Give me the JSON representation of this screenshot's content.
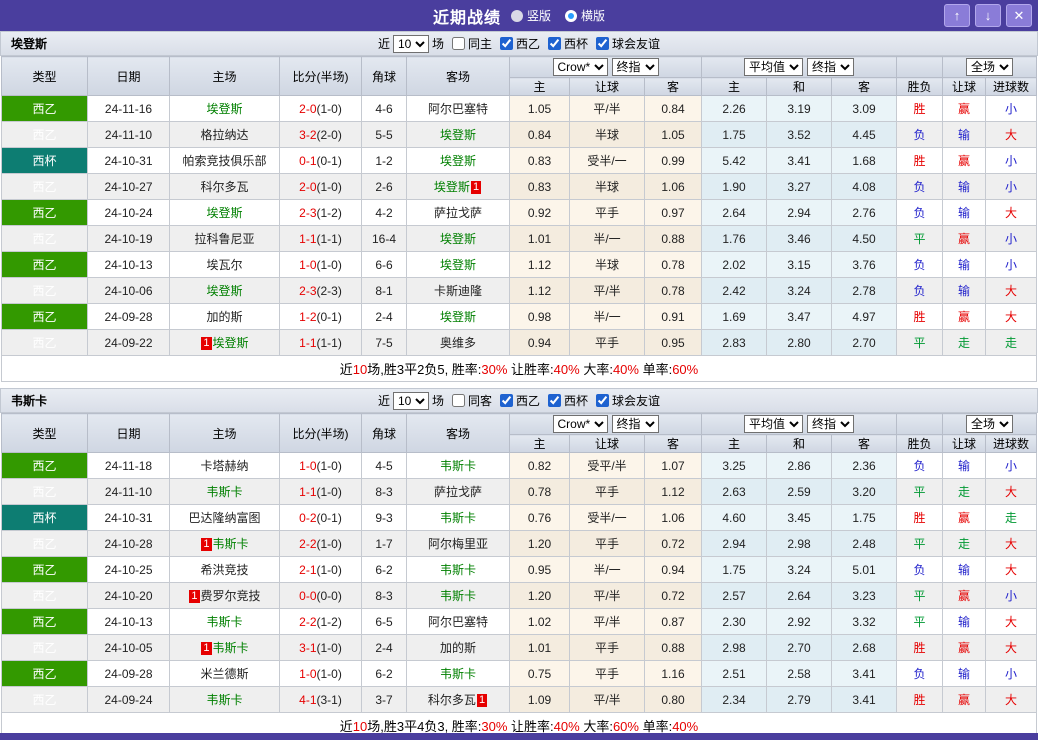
{
  "titlebar": {
    "title": "近期战绩",
    "radio_vertical": "竖版",
    "radio_horizontal": "横版",
    "btn_up": "↑",
    "btn_down": "↓",
    "btn_close": "✕",
    "bar_color": "#4a3e9e"
  },
  "table_header": {
    "cols": [
      "类型",
      "日期",
      "主场",
      "比分(半场)",
      "角球",
      "客场"
    ],
    "group1_selects": [
      "Crow*",
      "终指"
    ],
    "group1_sub": [
      "主",
      "让球",
      "客"
    ],
    "group2_selects": [
      "平均值",
      "终指"
    ],
    "group2_sub": [
      "主",
      "和",
      "客"
    ],
    "group3_select": "全场",
    "group3_sub": [
      "胜负",
      "让球",
      "进球数"
    ]
  },
  "colors": {
    "league_xiyi": "#339900",
    "league_xibei": "#0d7d72",
    "team_highlight": "#008000",
    "score_red": "#e60000",
    "win_red": "#e60000",
    "lose_blue": "#2222cc",
    "draw_green": "#009933"
  },
  "sections": [
    {
      "team": "埃登斯",
      "filter": {
        "near": "近",
        "count": "10",
        "games": "场",
        "same": "同主",
        "leagues": [
          {
            "label": "西乙",
            "checked": true
          },
          {
            "label": "西杯",
            "checked": true
          },
          {
            "label": "球会友谊",
            "checked": true
          }
        ],
        "same_checked": false
      },
      "rows": [
        {
          "lt": "西乙",
          "lc": "green",
          "date": "24-11-16",
          "home": "埃登斯",
          "hg": true,
          "hb": "",
          "score": "2-0",
          "half": "(1-0)",
          "corner": "4-6",
          "away": "阿尔巴塞特",
          "ag": false,
          "ab": "",
          "o1": [
            "1.05",
            "平/半",
            "0.84"
          ],
          "o2": [
            "2.26",
            "3.19",
            "3.09"
          ],
          "res": [
            [
              "胜",
              "r"
            ],
            [
              "赢",
              "r"
            ],
            [
              "小",
              "b"
            ]
          ]
        },
        {
          "lt": "西乙",
          "lc": "green",
          "date": "24-11-10",
          "home": "格拉纳达",
          "hg": false,
          "hb": "",
          "score": "3-2",
          "half": "(2-0)",
          "corner": "5-5",
          "away": "埃登斯",
          "ag": true,
          "ab": "",
          "o1": [
            "0.84",
            "半球",
            "1.05"
          ],
          "o2": [
            "1.75",
            "3.52",
            "4.45"
          ],
          "res": [
            [
              "负",
              "b"
            ],
            [
              "输",
              "b"
            ],
            [
              "大",
              "r"
            ]
          ]
        },
        {
          "lt": "西杯",
          "lc": "teal",
          "date": "24-10-31",
          "home": "帕索竞技俱乐部",
          "hg": false,
          "hb": "",
          "score": "0-1",
          "half": "(0-1)",
          "corner": "1-2",
          "away": "埃登斯",
          "ag": true,
          "ab": "",
          "o1": [
            "0.83",
            "受半/一",
            "0.99"
          ],
          "o2": [
            "5.42",
            "3.41",
            "1.68"
          ],
          "res": [
            [
              "胜",
              "r"
            ],
            [
              "赢",
              "r"
            ],
            [
              "小",
              "b"
            ]
          ]
        },
        {
          "lt": "西乙",
          "lc": "green",
          "date": "24-10-27",
          "home": "科尔多瓦",
          "hg": false,
          "hb": "",
          "score": "2-0",
          "half": "(1-0)",
          "corner": "2-6",
          "away": "埃登斯",
          "ag": true,
          "ab": "post",
          "o1": [
            "0.83",
            "半球",
            "1.06"
          ],
          "o2": [
            "1.90",
            "3.27",
            "4.08"
          ],
          "res": [
            [
              "负",
              "b"
            ],
            [
              "输",
              "b"
            ],
            [
              "小",
              "b"
            ]
          ]
        },
        {
          "lt": "西乙",
          "lc": "green",
          "date": "24-10-24",
          "home": "埃登斯",
          "hg": true,
          "hb": "",
          "score": "2-3",
          "half": "(1-2)",
          "corner": "4-2",
          "away": "萨拉戈萨",
          "ag": false,
          "ab": "",
          "o1": [
            "0.92",
            "平手",
            "0.97"
          ],
          "o2": [
            "2.64",
            "2.94",
            "2.76"
          ],
          "res": [
            [
              "负",
              "b"
            ],
            [
              "输",
              "b"
            ],
            [
              "大",
              "r"
            ]
          ]
        },
        {
          "lt": "西乙",
          "lc": "green",
          "date": "24-10-19",
          "home": "拉科鲁尼亚",
          "hg": false,
          "hb": "",
          "score": "1-1",
          "half": "(1-1)",
          "corner": "16-4",
          "away": "埃登斯",
          "ag": true,
          "ab": "",
          "o1": [
            "1.01",
            "半/一",
            "0.88"
          ],
          "o2": [
            "1.76",
            "3.46",
            "4.50"
          ],
          "res": [
            [
              "平",
              "g"
            ],
            [
              "赢",
              "r"
            ],
            [
              "小",
              "b"
            ]
          ]
        },
        {
          "lt": "西乙",
          "lc": "green",
          "date": "24-10-13",
          "home": "埃瓦尔",
          "hg": false,
          "hb": "",
          "score": "1-0",
          "half": "(1-0)",
          "corner": "6-6",
          "away": "埃登斯",
          "ag": true,
          "ab": "",
          "o1": [
            "1.12",
            "半球",
            "0.78"
          ],
          "o2": [
            "2.02",
            "3.15",
            "3.76"
          ],
          "res": [
            [
              "负",
              "b"
            ],
            [
              "输",
              "b"
            ],
            [
              "小",
              "b"
            ]
          ]
        },
        {
          "lt": "西乙",
          "lc": "green",
          "date": "24-10-06",
          "home": "埃登斯",
          "hg": true,
          "hb": "",
          "score": "2-3",
          "half": "(2-3)",
          "corner": "8-1",
          "away": "卡斯迪隆",
          "ag": false,
          "ab": "",
          "o1": [
            "1.12",
            "平/半",
            "0.78"
          ],
          "o2": [
            "2.42",
            "3.24",
            "2.78"
          ],
          "res": [
            [
              "负",
              "b"
            ],
            [
              "输",
              "b"
            ],
            [
              "大",
              "r"
            ]
          ]
        },
        {
          "lt": "西乙",
          "lc": "green",
          "date": "24-09-28",
          "home": "加的斯",
          "hg": false,
          "hb": "",
          "score": "1-2",
          "half": "(0-1)",
          "corner": "2-4",
          "away": "埃登斯",
          "ag": true,
          "ab": "",
          "o1": [
            "0.98",
            "半/一",
            "0.91"
          ],
          "o2": [
            "1.69",
            "3.47",
            "4.97"
          ],
          "res": [
            [
              "胜",
              "r"
            ],
            [
              "赢",
              "r"
            ],
            [
              "大",
              "r"
            ]
          ]
        },
        {
          "lt": "西乙",
          "lc": "green",
          "date": "24-09-22",
          "home": "埃登斯",
          "hg": true,
          "hb": "pre",
          "score": "1-1",
          "half": "(1-1)",
          "corner": "7-5",
          "away": "奥维多",
          "ag": false,
          "ab": "",
          "o1": [
            "0.94",
            "平手",
            "0.95"
          ],
          "o2": [
            "2.83",
            "2.80",
            "2.70"
          ],
          "res": [
            [
              "平",
              "g"
            ],
            [
              "走",
              "g"
            ],
            [
              "走",
              "g"
            ]
          ]
        }
      ],
      "summary": [
        {
          "t": "近",
          "red": false
        },
        {
          "t": "10",
          "red": true
        },
        {
          "t": "场,胜3平2负5, 胜率:",
          "red": false
        },
        {
          "t": "30%",
          "red": true
        },
        {
          "t": " 让胜率:",
          "red": false
        },
        {
          "t": "40%",
          "red": true
        },
        {
          "t": " 大率:",
          "red": false
        },
        {
          "t": "40%",
          "red": true
        },
        {
          "t": " 单率:",
          "red": false
        },
        {
          "t": "60%",
          "red": true
        }
      ]
    },
    {
      "team": "韦斯卡",
      "filter": {
        "near": "近",
        "count": "10",
        "games": "场",
        "same": "同客",
        "leagues": [
          {
            "label": "西乙",
            "checked": true
          },
          {
            "label": "西杯",
            "checked": true
          },
          {
            "label": "球会友谊",
            "checked": true
          }
        ],
        "same_checked": false
      },
      "rows": [
        {
          "lt": "西乙",
          "lc": "green",
          "date": "24-11-18",
          "home": "卡塔赫纳",
          "hg": false,
          "hb": "",
          "score": "1-0",
          "half": "(1-0)",
          "corner": "4-5",
          "away": "韦斯卡",
          "ag": true,
          "ab": "",
          "o1": [
            "0.82",
            "受平/半",
            "1.07"
          ],
          "o2": [
            "3.25",
            "2.86",
            "2.36"
          ],
          "res": [
            [
              "负",
              "b"
            ],
            [
              "输",
              "b"
            ],
            [
              "小",
              "b"
            ]
          ]
        },
        {
          "lt": "西乙",
          "lc": "green",
          "date": "24-11-10",
          "home": "韦斯卡",
          "hg": true,
          "hb": "",
          "score": "1-1",
          "half": "(1-0)",
          "corner": "8-3",
          "away": "萨拉戈萨",
          "ag": false,
          "ab": "",
          "o1": [
            "0.78",
            "平手",
            "1.12"
          ],
          "o2": [
            "2.63",
            "2.59",
            "3.20"
          ],
          "res": [
            [
              "平",
              "g"
            ],
            [
              "走",
              "g"
            ],
            [
              "大",
              "r"
            ]
          ]
        },
        {
          "lt": "西杯",
          "lc": "teal",
          "date": "24-10-31",
          "home": "巴达隆纳富图",
          "hg": false,
          "hb": "",
          "score": "0-2",
          "half": "(0-1)",
          "corner": "9-3",
          "away": "韦斯卡",
          "ag": true,
          "ab": "",
          "o1": [
            "0.76",
            "受半/一",
            "1.06"
          ],
          "o2": [
            "4.60",
            "3.45",
            "1.75"
          ],
          "res": [
            [
              "胜",
              "r"
            ],
            [
              "赢",
              "r"
            ],
            [
              "走",
              "g"
            ]
          ]
        },
        {
          "lt": "西乙",
          "lc": "green",
          "date": "24-10-28",
          "home": "韦斯卡",
          "hg": true,
          "hb": "pre",
          "score": "2-2",
          "half": "(1-0)",
          "corner": "1-7",
          "away": "阿尔梅里亚",
          "ag": false,
          "ab": "",
          "o1": [
            "1.20",
            "平手",
            "0.72"
          ],
          "o2": [
            "2.94",
            "2.98",
            "2.48"
          ],
          "res": [
            [
              "平",
              "g"
            ],
            [
              "走",
              "g"
            ],
            [
              "大",
              "r"
            ]
          ]
        },
        {
          "lt": "西乙",
          "lc": "green",
          "date": "24-10-25",
          "home": "希洪竞技",
          "hg": false,
          "hb": "",
          "score": "2-1",
          "half": "(1-0)",
          "corner": "6-2",
          "away": "韦斯卡",
          "ag": true,
          "ab": "",
          "o1": [
            "0.95",
            "半/一",
            "0.94"
          ],
          "o2": [
            "1.75",
            "3.24",
            "5.01"
          ],
          "res": [
            [
              "负",
              "b"
            ],
            [
              "输",
              "b"
            ],
            [
              "大",
              "r"
            ]
          ]
        },
        {
          "lt": "西乙",
          "lc": "green",
          "date": "24-10-20",
          "home": "费罗尔竞技",
          "hg": false,
          "hb": "pre",
          "score": "0-0",
          "half": "(0-0)",
          "corner": "8-3",
          "away": "韦斯卡",
          "ag": true,
          "ab": "",
          "o1": [
            "1.20",
            "平/半",
            "0.72"
          ],
          "o2": [
            "2.57",
            "2.64",
            "3.23"
          ],
          "res": [
            [
              "平",
              "g"
            ],
            [
              "赢",
              "r"
            ],
            [
              "小",
              "b"
            ]
          ]
        },
        {
          "lt": "西乙",
          "lc": "green",
          "date": "24-10-13",
          "home": "韦斯卡",
          "hg": true,
          "hb": "",
          "score": "2-2",
          "half": "(1-2)",
          "corner": "6-5",
          "away": "阿尔巴塞特",
          "ag": false,
          "ab": "",
          "o1": [
            "1.02",
            "平/半",
            "0.87"
          ],
          "o2": [
            "2.30",
            "2.92",
            "3.32"
          ],
          "res": [
            [
              "平",
              "g"
            ],
            [
              "输",
              "b"
            ],
            [
              "大",
              "r"
            ]
          ]
        },
        {
          "lt": "西乙",
          "lc": "green",
          "date": "24-10-05",
          "home": "韦斯卡",
          "hg": true,
          "hb": "pre",
          "score": "3-1",
          "half": "(1-0)",
          "corner": "2-4",
          "away": "加的斯",
          "ag": false,
          "ab": "",
          "o1": [
            "1.01",
            "平手",
            "0.88"
          ],
          "o2": [
            "2.98",
            "2.70",
            "2.68"
          ],
          "res": [
            [
              "胜",
              "r"
            ],
            [
              "赢",
              "r"
            ],
            [
              "大",
              "r"
            ]
          ]
        },
        {
          "lt": "西乙",
          "lc": "green",
          "date": "24-09-28",
          "home": "米兰德斯",
          "hg": false,
          "hb": "",
          "score": "1-0",
          "half": "(1-0)",
          "corner": "6-2",
          "away": "韦斯卡",
          "ag": true,
          "ab": "",
          "o1": [
            "0.75",
            "平手",
            "1.16"
          ],
          "o2": [
            "2.51",
            "2.58",
            "3.41"
          ],
          "res": [
            [
              "负",
              "b"
            ],
            [
              "输",
              "b"
            ],
            [
              "小",
              "b"
            ]
          ]
        },
        {
          "lt": "西乙",
          "lc": "green",
          "date": "24-09-24",
          "home": "韦斯卡",
          "hg": true,
          "hb": "",
          "score": "4-1",
          "half": "(3-1)",
          "corner": "3-7",
          "away": "科尔多瓦",
          "ag": false,
          "ab": "post",
          "o1": [
            "1.09",
            "平/半",
            "0.80"
          ],
          "o2": [
            "2.34",
            "2.79",
            "3.41"
          ],
          "res": [
            [
              "胜",
              "r"
            ],
            [
              "赢",
              "r"
            ],
            [
              "大",
              "r"
            ]
          ]
        }
      ],
      "summary": [
        {
          "t": "近",
          "red": false
        },
        {
          "t": "10",
          "red": true
        },
        {
          "t": "场,胜3平4负3, 胜率:",
          "red": false
        },
        {
          "t": "30%",
          "red": true
        },
        {
          "t": " 让胜率:",
          "red": false
        },
        {
          "t": "40%",
          "red": true
        },
        {
          "t": " 大率:",
          "red": false
        },
        {
          "t": "60%",
          "red": true
        },
        {
          "t": " 单率:",
          "red": false
        },
        {
          "t": "40%",
          "red": true
        }
      ]
    }
  ]
}
